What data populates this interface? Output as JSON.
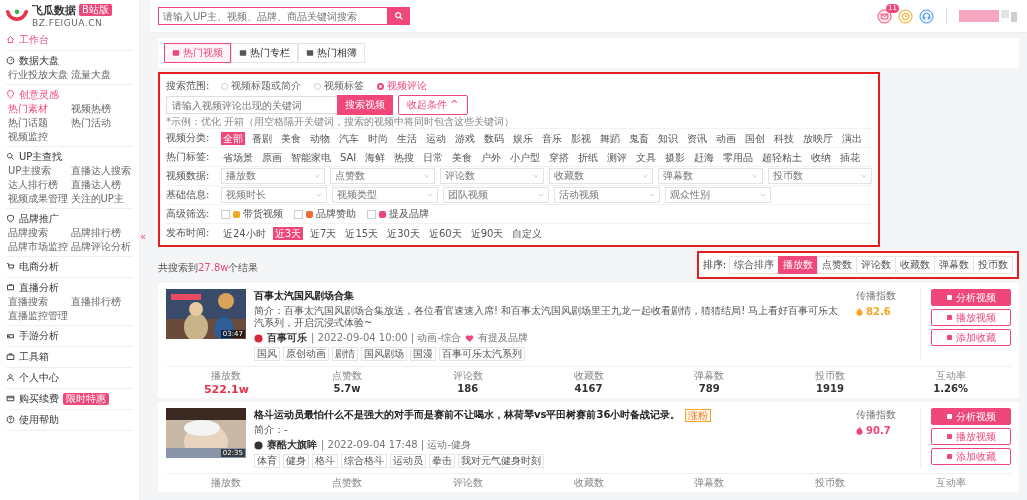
{
  "sidebar": {
    "logo": {
      "name": "飞瓜数据",
      "badge": "B站版",
      "domain": "BZ.FEIGUA.CN"
    },
    "collapse": "«",
    "sections": [
      {
        "label": "工作台",
        "active": true
      },
      {
        "label": "数据大盘",
        "active": false,
        "items": [
          {
            "label": "行业投放大盘",
            "selected": false
          },
          {
            "label": "流量大盘",
            "selected": false
          }
        ]
      },
      {
        "label": "创意灵感",
        "active": true,
        "items": [
          {
            "label": "热门素材",
            "selected": true
          },
          {
            "label": "视频热榜",
            "selected": false
          },
          {
            "label": "热门话题",
            "selected": false
          },
          {
            "label": "热门活动",
            "selected": false
          },
          {
            "label": "视频监控",
            "selected": false
          }
        ]
      },
      {
        "label": "UP主查找",
        "active": false,
        "items": [
          {
            "label": "UP主搜索",
            "selected": false
          },
          {
            "label": "直播达人搜索",
            "selected": false
          },
          {
            "label": "达人排行榜",
            "selected": false
          },
          {
            "label": "直播达人榜",
            "selected": false
          },
          {
            "label": "视频成果管理",
            "selected": false
          },
          {
            "label": "关注的UP主",
            "selected": false
          }
        ]
      },
      {
        "label": "品牌推广",
        "active": false,
        "items": [
          {
            "label": "品牌搜索",
            "selected": false
          },
          {
            "label": "品牌排行榜",
            "selected": false
          },
          {
            "label": "品牌市场监控",
            "selected": false
          },
          {
            "label": "品牌评论分析",
            "selected": false
          }
        ]
      },
      {
        "label": "电商分析",
        "active": false
      },
      {
        "label": "直播分析",
        "active": false,
        "items": [
          {
            "label": "直播搜索",
            "selected": false
          },
          {
            "label": "直播排行榜",
            "selected": false
          },
          {
            "label": "直播监控管理",
            "selected": false
          }
        ]
      },
      {
        "label": "手游分析",
        "active": false
      },
      {
        "label": "工具箱",
        "active": false
      },
      {
        "label": "个人中心",
        "active": false
      },
      {
        "label": "购买续费",
        "active": false,
        "badge": "限时特惠"
      },
      {
        "label": "使用帮助",
        "active": false
      }
    ]
  },
  "header": {
    "search": {
      "placeholder": "请输入UP主、视频、品牌、商品关键词搜索"
    },
    "notifications": "11"
  },
  "tabs": [
    {
      "label": "热门视频",
      "selected": true
    },
    {
      "label": "热门专栏",
      "selected": false
    },
    {
      "label": "热门相簿",
      "selected": false
    }
  ],
  "filters": {
    "scope": {
      "label": "搜索范围:",
      "options": [
        {
          "label": "视频标题或简介",
          "selected": false
        },
        {
          "label": "视频标签",
          "selected": false
        },
        {
          "label": "视频评论",
          "selected": true
        }
      ]
    },
    "keyword": {
      "placeholder": "请输入视频评论出现的关键词",
      "search_button": "搜索视频",
      "collapse_button": "收起条件 ^"
    },
    "hint": "*示例：优化 开箱（用空格隔开关键词，搜索的视频中将同时包含这些关键词）",
    "chip_rows": [
      {
        "label": "视频分类:",
        "options": [
          {
            "label": "全部",
            "selected": true
          },
          {
            "label": "番剧",
            "selected": false
          },
          {
            "label": "美食",
            "selected": false
          },
          {
            "label": "动物",
            "selected": false
          },
          {
            "label": "汽车",
            "selected": false
          },
          {
            "label": "时尚",
            "selected": false
          },
          {
            "label": "生活",
            "selected": false
          },
          {
            "label": "运动",
            "selected": false
          },
          {
            "label": "游戏",
            "selected": false
          },
          {
            "label": "数码",
            "selected": false
          },
          {
            "label": "娱乐",
            "selected": false
          },
          {
            "label": "音乐",
            "selected": false
          },
          {
            "label": "影视",
            "selected": false
          },
          {
            "label": "舞蹈",
            "selected": false
          },
          {
            "label": "鬼畜",
            "selected": false
          },
          {
            "label": "知识",
            "selected": false
          },
          {
            "label": "资讯",
            "selected": false
          },
          {
            "label": "动画",
            "selected": false
          },
          {
            "label": "国创",
            "selected": false
          },
          {
            "label": "科技",
            "selected": false
          },
          {
            "label": "放映厅",
            "selected": false
          },
          {
            "label": "演出",
            "selected": false
          }
        ]
      },
      {
        "label": "热门标签:",
        "options": [
          {
            "label": "省场景",
            "selected": false
          },
          {
            "label": "原画",
            "selected": false
          },
          {
            "label": "智能家电",
            "selected": false
          },
          {
            "label": "SAI",
            "selected": false
          },
          {
            "label": "海鲜",
            "selected": false
          },
          {
            "label": "热搜",
            "selected": false
          },
          {
            "label": "日常",
            "selected": false
          },
          {
            "label": "美食",
            "selected": false
          },
          {
            "label": "户外",
            "selected": false
          },
          {
            "label": "小户型",
            "selected": false
          },
          {
            "label": "穿搭",
            "selected": false
          },
          {
            "label": "折纸",
            "selected": false
          },
          {
            "label": "测评",
            "selected": false
          },
          {
            "label": "文具",
            "selected": false
          },
          {
            "label": "摄影",
            "selected": false
          },
          {
            "label": "赶海",
            "selected": false
          },
          {
            "label": "零用品",
            "selected": false
          },
          {
            "label": "超轻粘土",
            "selected": false
          },
          {
            "label": "收纳",
            "selected": false
          },
          {
            "label": "插花",
            "selected": false
          }
        ]
      }
    ],
    "dropdown_rows": [
      {
        "label": "视频数据:",
        "dropdowns": [
          "播放数",
          "点赞数",
          "评论数",
          "收藏数",
          "弹幕数",
          "投币数"
        ]
      },
      {
        "label": "基础信息:",
        "dropdowns": [
          "视频时长",
          "视频类型",
          "团队视频",
          "活动视频",
          "观众性别"
        ]
      }
    ],
    "advanced": {
      "label": "高级筛选:",
      "options": [
        {
          "label": "带货视频",
          "checked": false,
          "color": "#f5a623"
        },
        {
          "label": "品牌赞助",
          "checked": false,
          "color": "#f06a35"
        },
        {
          "label": "提及品牌",
          "checked": false,
          "color": "#f0477a"
        }
      ]
    },
    "time": {
      "label": "发布时间:",
      "options": [
        {
          "label": "近24小时",
          "selected": false
        },
        {
          "label": "近3天",
          "selected": true
        },
        {
          "label": "近7天",
          "selected": false
        },
        {
          "label": "近15天",
          "selected": false
        },
        {
          "label": "近30天",
          "selected": false
        },
        {
          "label": "近60天",
          "selected": false
        },
        {
          "label": "近90天",
          "selected": false
        },
        {
          "label": "自定义",
          "selected": false
        }
      ]
    }
  },
  "summary": {
    "prefix": "共搜索到",
    "count": "27.8w",
    "suffix": "个结果"
  },
  "sort": {
    "label": "排序:",
    "options": [
      {
        "label": "综合排序",
        "selected": false
      },
      {
        "label": "播放数",
        "selected": true
      },
      {
        "label": "点赞数",
        "selected": false
      },
      {
        "label": "评论数",
        "selected": false
      },
      {
        "label": "收藏数",
        "selected": false
      },
      {
        "label": "弹幕数",
        "selected": false
      },
      {
        "label": "投币数",
        "selected": false
      }
    ]
  },
  "videos": [
    {
      "title": "百事太汽国风剧场合集",
      "description": "简介：百事太汽国风剧场合集放送，各位看官速速入席! 和百事太汽国风剧场里王九龙一起收看剧情，猜猜结局! 马上看好百事可乐太汽系列，开启沉浸式体验~",
      "duration": "03:47",
      "author": "百事可乐",
      "meta": "| 2022-09-04 10:00 | 动画-综合",
      "brand_mention": "有提及品牌",
      "tags": [
        "国风",
        "原创动画",
        "剧情",
        "国风剧场",
        "国漫",
        "百事可乐太汽系列"
      ],
      "index_label": "传播指数",
      "index": "82.6",
      "color": "#f5a623",
      "actions": [
        "分析视频",
        "播放视频",
        "添加收藏"
      ],
      "stats": [
        {
          "label": "播放数",
          "value": "522.1w",
          "highlight": true
        },
        {
          "label": "点赞数",
          "value": "5.7w",
          "highlight": false
        },
        {
          "label": "评论数",
          "value": "186",
          "highlight": false
        },
        {
          "label": "收藏数",
          "value": "4167",
          "highlight": false
        },
        {
          "label": "弹幕数",
          "value": "789",
          "highlight": false
        },
        {
          "label": "投币数",
          "value": "1919",
          "highlight": false
        },
        {
          "label": "互动率",
          "value": "1.26%",
          "highlight": false
        }
      ]
    },
    {
      "title": "格斗运动员最怕什么不是强大的对手而是赛前不让喝水，林荷琴vs平田树赛前36小时备战记录。",
      "badge": "涨粉",
      "description": "简介：-",
      "duration": "02:35",
      "author": "赛酷大旗眸",
      "meta": "| 2022-09-04 17:48 | 运动-健身",
      "tags": [
        "体育",
        "健身",
        "格斗",
        "综合格斗",
        "运动员",
        "拳击",
        "我对元气健身时刻"
      ],
      "index_label": "传播指数",
      "index": "90.7",
      "color": "#f0477a",
      "actions": [
        "分析视频",
        "播放视频",
        "添加收藏"
      ],
      "stats": [
        {
          "label": "播放数"
        },
        {
          "label": "点赞数"
        },
        {
          "label": "评论数"
        },
        {
          "label": "收藏数"
        },
        {
          "label": "弹幕数"
        },
        {
          "label": "投币数"
        },
        {
          "label": "互动率"
        }
      ]
    }
  ]
}
